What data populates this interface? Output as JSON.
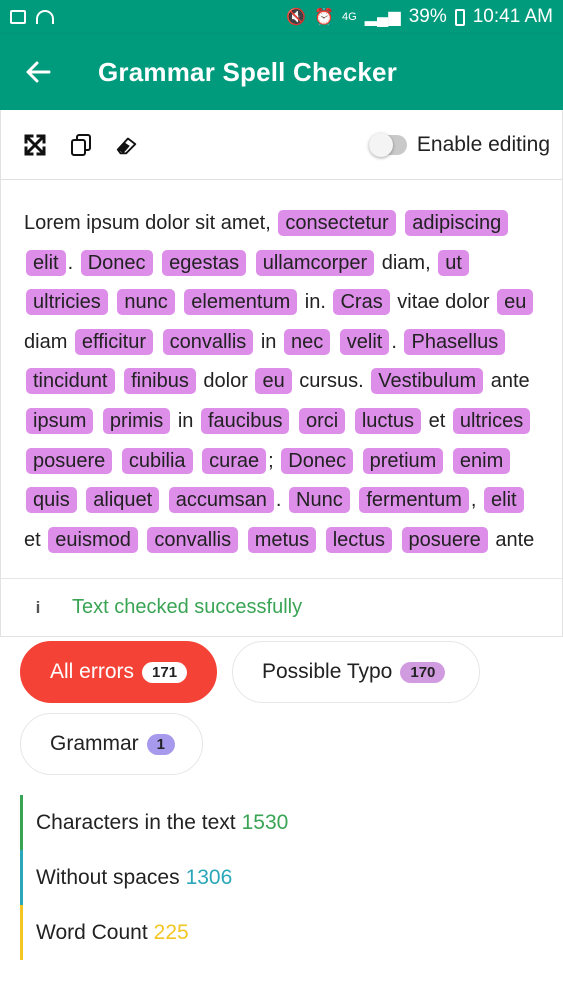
{
  "status_bar": {
    "battery": "39%",
    "network": "4G",
    "time": "10:41 AM"
  },
  "app_bar": {
    "title": "Grammar Spell Checker"
  },
  "toolbar": {
    "toggle_label": "Enable editing"
  },
  "text_segments": [
    {
      "t": "Lorem ipsum dolor sit amet, ",
      "h": false
    },
    {
      "t": "consectetur",
      "h": true
    },
    {
      "t": " ",
      "h": false
    },
    {
      "t": "adipiscing",
      "h": true
    },
    {
      "t": " ",
      "h": false
    },
    {
      "t": "elit",
      "h": true
    },
    {
      "t": ". ",
      "h": false
    },
    {
      "t": "Donec",
      "h": true
    },
    {
      "t": " ",
      "h": false
    },
    {
      "t": "egestas",
      "h": true
    },
    {
      "t": " ",
      "h": false
    },
    {
      "t": "ullamcorper",
      "h": true
    },
    {
      "t": " diam, ",
      "h": false
    },
    {
      "t": "ut",
      "h": true
    },
    {
      "t": " ",
      "h": false
    },
    {
      "t": "ultricies",
      "h": true
    },
    {
      "t": " ",
      "h": false
    },
    {
      "t": "nunc",
      "h": true
    },
    {
      "t": " ",
      "h": false
    },
    {
      "t": "elementum",
      "h": true
    },
    {
      "t": " in. ",
      "h": false
    },
    {
      "t": "Cras",
      "h": true
    },
    {
      "t": " vitae dolor ",
      "h": false
    },
    {
      "t": "eu",
      "h": true
    },
    {
      "t": " diam ",
      "h": false
    },
    {
      "t": "efficitur",
      "h": true
    },
    {
      "t": " ",
      "h": false
    },
    {
      "t": "convallis",
      "h": true
    },
    {
      "t": " in ",
      "h": false
    },
    {
      "t": "nec",
      "h": true
    },
    {
      "t": " ",
      "h": false
    },
    {
      "t": "velit",
      "h": true
    },
    {
      "t": ". ",
      "h": false
    },
    {
      "t": "Phasellus",
      "h": true
    },
    {
      "t": " ",
      "h": false
    },
    {
      "t": "tincidunt",
      "h": true
    },
    {
      "t": " ",
      "h": false
    },
    {
      "t": "finibus",
      "h": true
    },
    {
      "t": " dolor ",
      "h": false
    },
    {
      "t": "eu",
      "h": true
    },
    {
      "t": " cursus. ",
      "h": false
    },
    {
      "t": "Vestibulum",
      "h": true
    },
    {
      "t": " ante ",
      "h": false
    },
    {
      "t": "ipsum",
      "h": true
    },
    {
      "t": " ",
      "h": false
    },
    {
      "t": "primis",
      "h": true
    },
    {
      "t": " in ",
      "h": false
    },
    {
      "t": "faucibus",
      "h": true
    },
    {
      "t": " ",
      "h": false
    },
    {
      "t": "orci",
      "h": true
    },
    {
      "t": " ",
      "h": false
    },
    {
      "t": "luctus",
      "h": true
    },
    {
      "t": " et ",
      "h": false
    },
    {
      "t": "ultrices",
      "h": true
    },
    {
      "t": " ",
      "h": false
    },
    {
      "t": "posuere",
      "h": true
    },
    {
      "t": " ",
      "h": false
    },
    {
      "t": "cubilia",
      "h": true
    },
    {
      "t": " ",
      "h": false
    },
    {
      "t": "curae",
      "h": true
    },
    {
      "t": "; ",
      "h": false
    },
    {
      "t": "Donec",
      "h": true
    },
    {
      "t": " ",
      "h": false
    },
    {
      "t": "pretium",
      "h": true
    },
    {
      "t": " ",
      "h": false
    },
    {
      "t": "enim",
      "h": true
    },
    {
      "t": " ",
      "h": false
    },
    {
      "t": "quis",
      "h": true
    },
    {
      "t": " ",
      "h": false
    },
    {
      "t": "aliquet",
      "h": true
    },
    {
      "t": " ",
      "h": false
    },
    {
      "t": "accumsan",
      "h": true
    },
    {
      "t": ". ",
      "h": false
    },
    {
      "t": "Nunc",
      "h": true
    },
    {
      "t": " ",
      "h": false
    },
    {
      "t": "fermentum",
      "h": true
    },
    {
      "t": ", ",
      "h": false
    },
    {
      "t": "elit",
      "h": true
    },
    {
      "t": " et ",
      "h": false
    },
    {
      "t": "euismod",
      "h": true
    },
    {
      "t": " ",
      "h": false
    },
    {
      "t": "convallis",
      "h": true
    },
    {
      "t": " ",
      "h": false
    },
    {
      "t": "metus",
      "h": true
    },
    {
      "t": " ",
      "h": false
    },
    {
      "t": "lectus",
      "h": true
    },
    {
      "t": " ",
      "h": false
    },
    {
      "t": "posuere",
      "h": true
    },
    {
      "t": " ante",
      "h": false
    }
  ],
  "status": {
    "message": "Text checked successfully"
  },
  "filters": [
    {
      "label": "All errors",
      "count": "171",
      "active": true
    },
    {
      "label": "Possible Typo",
      "count": "170",
      "active": false
    },
    {
      "label": "Grammar",
      "count": "1",
      "active": false
    }
  ],
  "stats": [
    {
      "label": "Characters in the text",
      "value": "1530",
      "color": "#3aa455"
    },
    {
      "label": "Without spaces",
      "value": "1306",
      "color": "#2aa7b8"
    },
    {
      "label": "Word Count",
      "value": "225",
      "color": "#f3c623"
    }
  ],
  "colors": {
    "primary": "#009b7d",
    "highlight": "#dc8ee9",
    "active_chip": "#f44336"
  }
}
